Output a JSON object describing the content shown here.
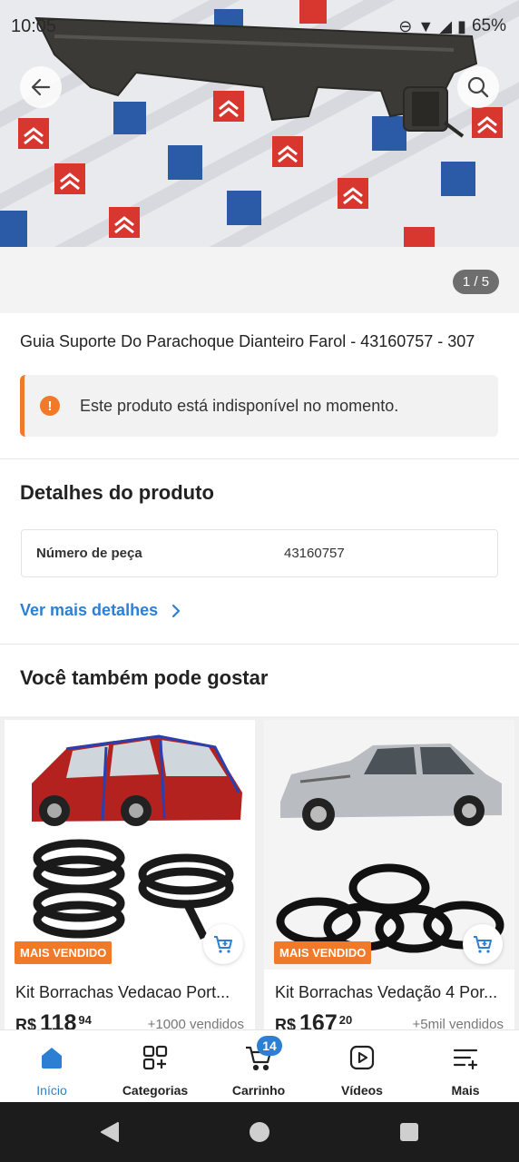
{
  "status_bar": {
    "time": "10:05",
    "battery": "65%"
  },
  "gallery": {
    "counter": "1 / 5"
  },
  "product": {
    "title": "Guia Suporte Do Parachoque Dianteiro Farol - 43160757 - 307",
    "notice": "Este produto está indisponível no momento."
  },
  "details": {
    "heading": "Detalhes do produto",
    "rows": [
      {
        "key": "Número de peça",
        "value": "43160757"
      }
    ],
    "more_link": "Ver mais detalhes"
  },
  "recommendations": {
    "heading": "Você também pode gostar",
    "items": [
      {
        "badge": "MAIS VENDIDO",
        "name": "Kit Borrachas Vedacao Port...",
        "currency": "R$",
        "price_int": "118",
        "price_cents": "94",
        "sold": "+1000 vendidos"
      },
      {
        "badge": "MAIS VENDIDO",
        "name": "Kit Borrachas Vedação 4 Por...",
        "currency": "R$",
        "price_int": "167",
        "price_cents": "20",
        "sold": "+5mil vendidos"
      }
    ]
  },
  "bottom_nav": {
    "items": [
      {
        "label": "Início",
        "icon": "home-icon",
        "active": true
      },
      {
        "label": "Categorias",
        "icon": "categories-icon"
      },
      {
        "label": "Carrinho",
        "icon": "cart-icon",
        "badge": "14"
      },
      {
        "label": "Vídeos",
        "icon": "video-icon"
      },
      {
        "label": "Mais",
        "icon": "more-icon"
      }
    ]
  },
  "colors": {
    "accent": "#2d7fd3",
    "warning": "#f07a2a"
  }
}
